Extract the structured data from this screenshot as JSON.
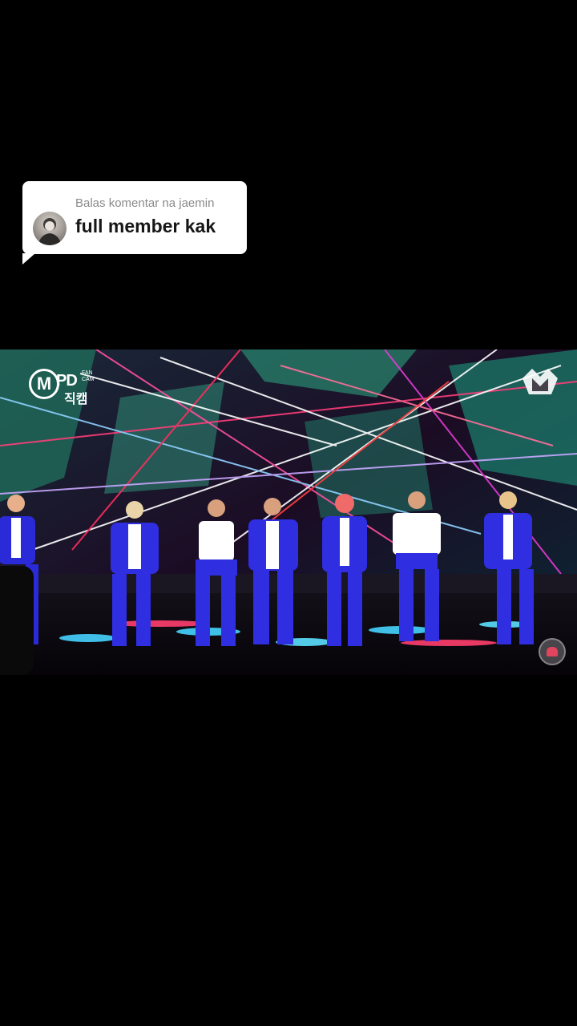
{
  "reply_sticker": {
    "header": "Balas komentar na jaemin",
    "comment": "full member kak"
  },
  "video": {
    "logo_left": {
      "letter": "M",
      "brand": "PD",
      "tag": "FAN CAM",
      "korean": "직캠"
    },
    "logo_right_icon": "m2-logo-icon",
    "corner_icon": "channel-watermark-icon"
  }
}
